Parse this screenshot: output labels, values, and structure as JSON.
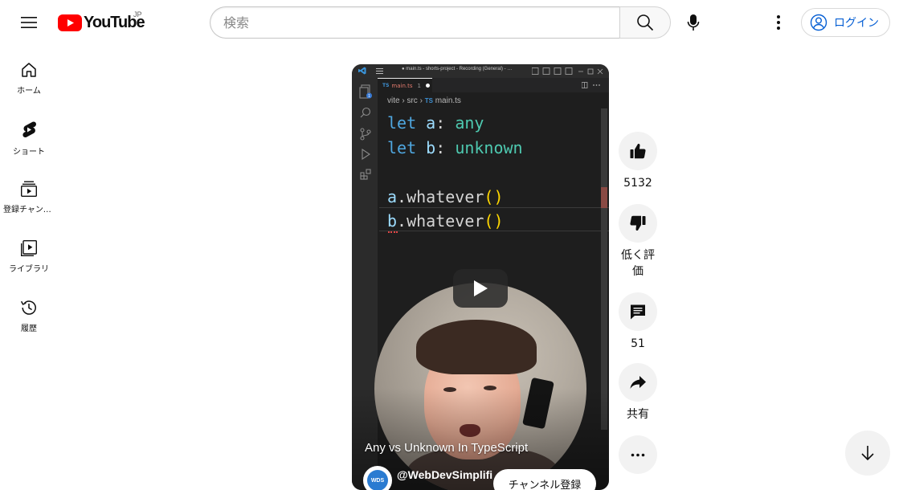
{
  "header": {
    "logo_text": "YouTube",
    "region": "JP",
    "search_placeholder": "検索",
    "login_label": "ログイン"
  },
  "guide": {
    "items": [
      {
        "label": "ホーム",
        "icon": "home-icon"
      },
      {
        "label": "ショート",
        "icon": "shorts-icon"
      },
      {
        "label": "登録チャンネル",
        "icon": "subscriptions-icon"
      },
      {
        "label": "ライブラリ",
        "icon": "library-icon"
      },
      {
        "label": "履歴",
        "icon": "history-icon"
      }
    ]
  },
  "player": {
    "editor": {
      "window_title": "● main.ts - shorts-project - Recording (General) - …",
      "tab_name": "main.ts",
      "tab_lang": "TS",
      "tab_count": "1",
      "breadcrumb": [
        "vite",
        "src",
        "main.ts"
      ],
      "explorer_badge": "1"
    },
    "title": "Any vs Unknown In TypeScript",
    "channel": "@WebDevSimplifi",
    "channel_avatar_text": "WDS",
    "subscribe_label": "チャンネル登録"
  },
  "actions": {
    "like_count": "5132",
    "dislike_label": "低く評価",
    "comment_count": "51",
    "share_label": "共有"
  },
  "colors": {
    "brand_red": "#ff0000",
    "link_blue": "#065fd4",
    "editor_bg": "#1e1e1e"
  }
}
